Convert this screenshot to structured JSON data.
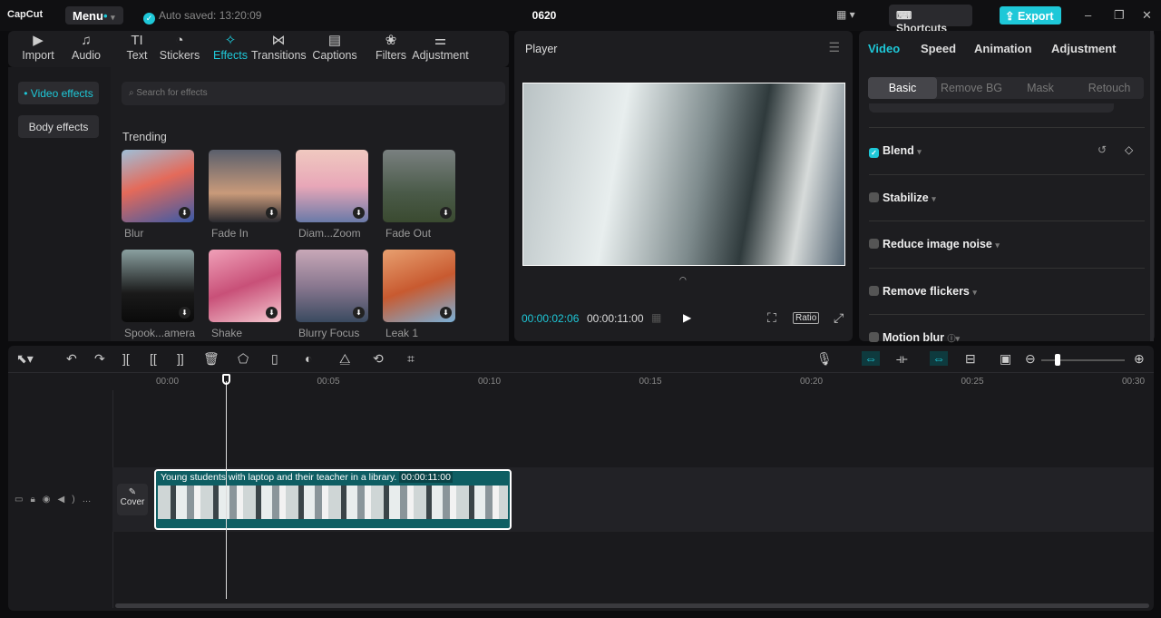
{
  "app": {
    "logo": "CapCut",
    "menu": "Menu",
    "saved": "Auto saved: 13:20:09",
    "title": "0620",
    "shortcuts": "Shortcuts",
    "export": "Export"
  },
  "toolbar": [
    {
      "icon": "▶",
      "label": "Import"
    },
    {
      "icon": "♫",
      "label": "Audio"
    },
    {
      "icon": "TI",
      "label": "Text"
    },
    {
      "icon": "◔",
      "label": "Stickers"
    },
    {
      "icon": "✧",
      "label": "Effects"
    },
    {
      "icon": "⋈",
      "label": "Transitions"
    },
    {
      "icon": "▤",
      "label": "Captions"
    },
    {
      "icon": "❀",
      "label": "Filters"
    },
    {
      "icon": "⚌",
      "label": "Adjustment"
    }
  ],
  "sidebar": {
    "video_effects": "• Video effects",
    "body_effects": "Body effects"
  },
  "search": {
    "placeholder": "Search for effects"
  },
  "section": "Trending",
  "effects": [
    {
      "label": "Blur",
      "bg": "linear-gradient(160deg,#9fbfd8,#e46a5a 45%,#3a5aa8)"
    },
    {
      "label": "Fade In",
      "bg": "linear-gradient(180deg,#5a5f6c,#c99a7a 60%,#2a2a30)"
    },
    {
      "label": "Diam...Zoom",
      "bg": "linear-gradient(180deg,#f0c9c0,#e8a7b8 50%,#6a7aa8)"
    },
    {
      "label": "Fade Out",
      "bg": "linear-gradient(180deg,#7a8080,#4a5a48 60%,#3a4a30)"
    },
    {
      "label": "Spook...amera",
      "bg": "linear-gradient(180deg,#8aa0a0,#1a1a1a 60%,#0a0a0a)"
    },
    {
      "label": "Shake",
      "bg": "linear-gradient(160deg,#f0a0b8,#c85078 50%,#f5c8d0)"
    },
    {
      "label": "Blurry Focus",
      "bg": "linear-gradient(180deg,#c8a8b8,#8a7890 50%,#3a4a60)"
    },
    {
      "label": "Leak 1",
      "bg": "linear-gradient(160deg,#e8a070,#c85a30 50%,#7ab0d8)"
    }
  ],
  "player": {
    "title": "Player",
    "current": "00:00:02:06",
    "total": "00:00:11:00",
    "ratio": "Ratio"
  },
  "right": {
    "tabs": [
      "Video",
      "Speed",
      "Animation",
      "Adjustment"
    ],
    "subtabs": [
      "Basic",
      "Remove BG",
      "Mask",
      "Retouch"
    ],
    "options": [
      {
        "label": "Blend",
        "checked": true
      },
      {
        "label": "Stabilize",
        "checked": false
      },
      {
        "label": "Reduce image noise",
        "checked": false
      },
      {
        "label": "Remove flickers",
        "checked": false
      },
      {
        "label": "Motion blur",
        "checked": false
      }
    ]
  },
  "timeline": {
    "ruler": [
      "00:00",
      "00:05",
      "00:10",
      "00:15",
      "00:20",
      "00:25",
      "00:30"
    ],
    "clip_title": "Young students with laptop and their teacher in a library.",
    "clip_duration": "00:00:11:00",
    "cover": "Cover"
  }
}
